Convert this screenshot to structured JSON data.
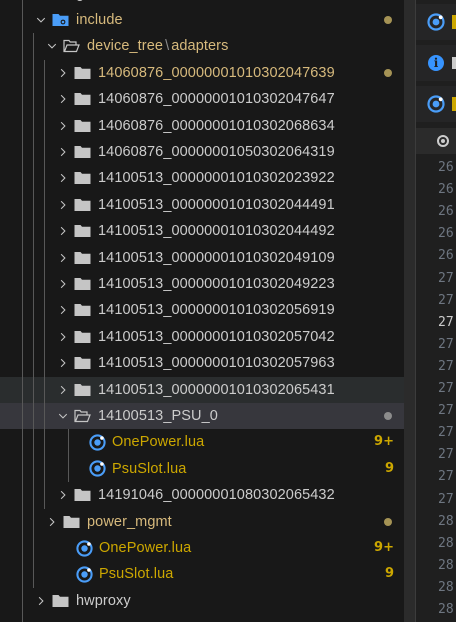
{
  "explorer": {
    "top_partial_label": "g",
    "items": [
      {
        "label": "include",
        "type": "folder",
        "open": true,
        "color": "mod",
        "decoration": "dot",
        "folder_icon": "blue"
      },
      {
        "label_parts": [
          "device_tree",
          "adapters"
        ],
        "separator": "\\",
        "type": "folder",
        "open": true,
        "color": "mod"
      },
      {
        "label": "14060876_0000000101030204763​9",
        "type": "folder",
        "open": false,
        "color": "mod",
        "decoration": "dot"
      },
      {
        "label": "14060876_00000001010302047647",
        "type": "folder",
        "open": false
      },
      {
        "label": "14060876_00000001010302068634",
        "type": "folder",
        "open": false
      },
      {
        "label": "14060876_00000001050302064319",
        "type": "folder",
        "open": false
      },
      {
        "label": "14100513_00000001010302023922",
        "type": "folder",
        "open": false
      },
      {
        "label": "14100513_00000001010302044491",
        "type": "folder",
        "open": false
      },
      {
        "label": "14100513_00000001010302044492",
        "type": "folder",
        "open": false
      },
      {
        "label": "14100513_00000001010302049109",
        "type": "folder",
        "open": false
      },
      {
        "label": "14100513_00000001010302049223",
        "type": "folder",
        "open": false
      },
      {
        "label": "14100513_00000001010302056919",
        "type": "folder",
        "open": false
      },
      {
        "label": "14100513_00000001010302057042",
        "type": "folder",
        "open": false
      },
      {
        "label": "14100513_00000001010302057963",
        "type": "folder",
        "open": false
      },
      {
        "label": "14100513_00000001010302065431",
        "type": "folder",
        "open": false,
        "state": "hover"
      },
      {
        "label": "14100513_PSU_0",
        "type": "folder",
        "open": true,
        "state": "selected",
        "decoration": "grey-dot"
      },
      {
        "label": "OnePower.lua",
        "type": "file",
        "color": "warn",
        "badge": "9+"
      },
      {
        "label": "PsuSlot.lua",
        "type": "file",
        "color": "warn",
        "badge": "9"
      },
      {
        "label": "14191046_00000001080302065432",
        "type": "folder",
        "open": false
      },
      {
        "label": "power_mgmt",
        "type": "folder",
        "open": false,
        "color": "mod",
        "decoration": "dot"
      },
      {
        "label": "OnePower.lua",
        "type": "file",
        "color": "warn",
        "badge": "9+"
      },
      {
        "label": "PsuSlot.lua",
        "type": "file",
        "color": "warn",
        "badge": "9"
      },
      {
        "label": "hwproxy",
        "type": "folder",
        "open": false
      }
    ]
  },
  "editor": {
    "notifications": [
      {
        "icon": "lua-file-icon"
      },
      {
        "icon": "info-icon"
      },
      {
        "icon": "lua-file-icon"
      }
    ],
    "line_numbers": [
      "26",
      "26",
      "26",
      "26",
      "26",
      "27",
      "27",
      "27",
      "27",
      "27",
      "27",
      "27",
      "27",
      "27",
      "27",
      "27",
      "28",
      "28",
      "28",
      "28",
      "28"
    ],
    "active_line_index": 7
  },
  "colors": {
    "background": "#181818",
    "modified_folder": "#d7ba7d",
    "warning_file": "#cca700",
    "lua_icon": "#4a9df8",
    "folder_icon": "#c5c5c5"
  }
}
